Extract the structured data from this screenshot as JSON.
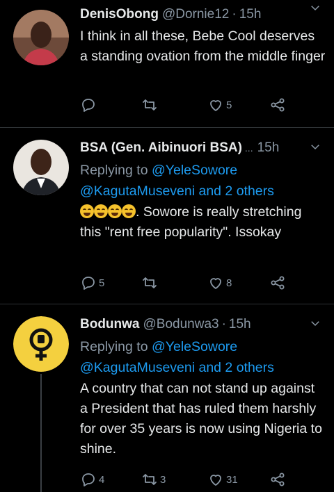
{
  "tweets": [
    {
      "name": "DenisObong",
      "handle": "@Dornie12",
      "time": "15h",
      "reply_prefix": "",
      "reply_to": "",
      "reply_others": "",
      "text": "I think in all these, Bebe Cool deserves a standing ovation from the middle finger",
      "emoji_count": 0,
      "replies": "",
      "retweets": "",
      "likes": "5"
    },
    {
      "name": "BSA (Gen. Aibinuori BSA)",
      "handle": "...",
      "time": "15h",
      "reply_prefix": "Replying to",
      "reply_to": "@YeleSowore",
      "reply_others": "@KagutaMuseveni and 2 others",
      "text": ". Sowore is really stretching this \"rent free popularity\". Issokay",
      "emoji_count": 4,
      "replies": "5",
      "retweets": "",
      "likes": "8"
    },
    {
      "name": "Bodunwa",
      "handle": "@Bodunwa3",
      "time": "15h",
      "reply_prefix": "Replying to",
      "reply_to": "@YeleSowore",
      "reply_others": "@KagutaMuseveni and 2 others",
      "text": "A country that can not stand up against a President that has ruled them harshly for over 35 years is now using Nigeria to shine.",
      "emoji_count": 0,
      "replies": "4",
      "retweets": "3",
      "likes": "31"
    }
  ],
  "colors": {
    "background": "#000000",
    "accent": "#1d9bf0",
    "secondary_text": "#8b98a5",
    "divider": "#2f3336"
  },
  "icons": [
    "reply-icon",
    "retweet-icon",
    "like-icon",
    "share-icon",
    "chevron-down-icon"
  ]
}
